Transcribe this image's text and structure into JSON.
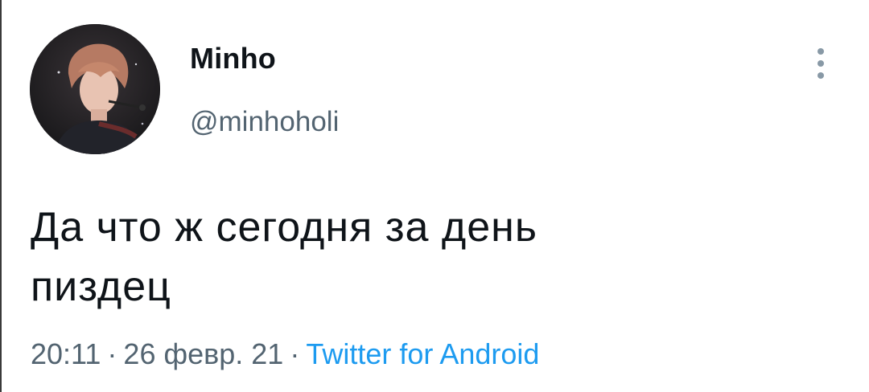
{
  "tweet": {
    "display_name": "Minho",
    "handle": "@minhoholi",
    "text_line1": "Да что ж сегодня за день",
    "text_line2": "пиздец",
    "time": "20:11",
    "separator": "·",
    "date": "26 февр. 21",
    "source": "Twitter for Android"
  },
  "colors": {
    "text": "#0f1419",
    "secondary": "#536471",
    "link": "#1d9bf0",
    "more_icon": "#8899a6"
  },
  "icons": {
    "more": "more-vertical-icon",
    "avatar": "profile-photo"
  }
}
